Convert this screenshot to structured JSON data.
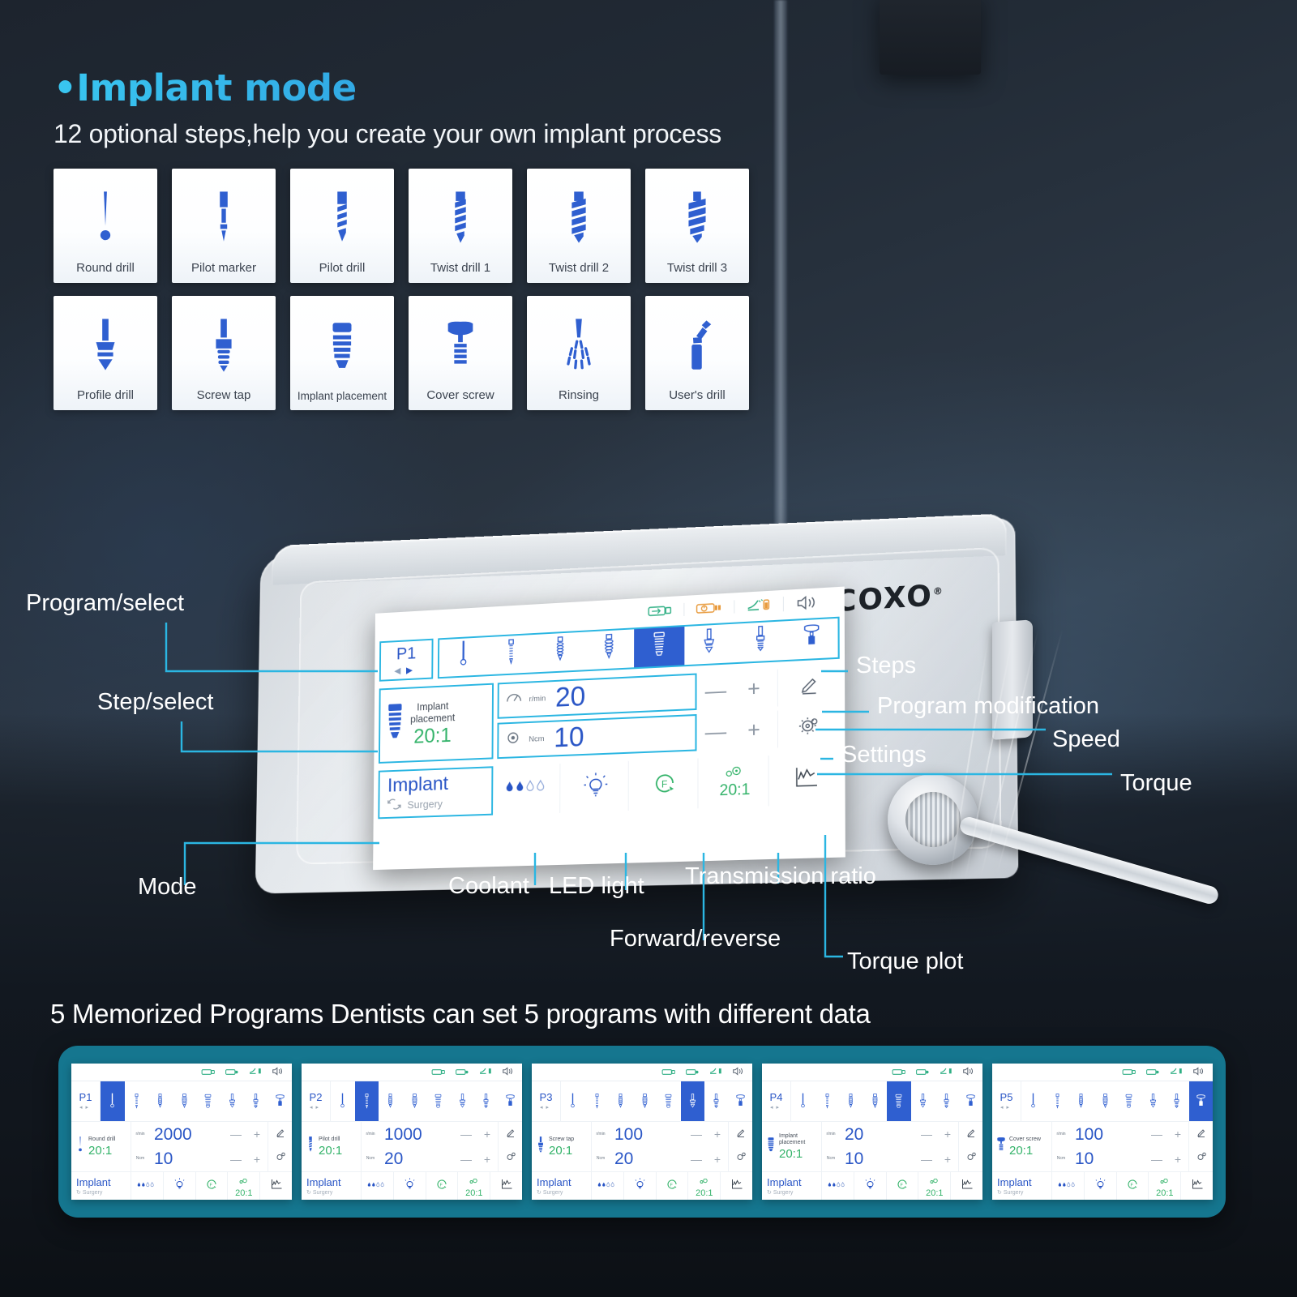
{
  "header": {
    "bullet": "•",
    "title": "Implant mode",
    "subtitle": "12 optional steps,help you create your own implant process"
  },
  "steps_grid": [
    {
      "label": "Round drill",
      "icon": "round-drill-icon"
    },
    {
      "label": "Pilot marker",
      "icon": "pilot-marker-icon"
    },
    {
      "label": "Pilot drill",
      "icon": "pilot-drill-icon"
    },
    {
      "label": "Twist drill 1",
      "icon": "twist-drill-1-icon"
    },
    {
      "label": "Twist drill 2",
      "icon": "twist-drill-2-icon"
    },
    {
      "label": "Twist drill 3",
      "icon": "twist-drill-3-icon"
    },
    {
      "label": "Profile drill",
      "icon": "profile-drill-icon"
    },
    {
      "label": "Screw tap",
      "icon": "screw-tap-icon"
    },
    {
      "label": "Implant placement",
      "icon": "implant-placement-icon"
    },
    {
      "label": "Cover screw",
      "icon": "cover-screw-icon"
    },
    {
      "label": "Rinsing",
      "icon": "rinsing-icon"
    },
    {
      "label": "User's drill",
      "icon": "users-drill-icon"
    }
  ],
  "device": {
    "brand": "COXO",
    "brand_mark": "®"
  },
  "screen": {
    "status_icons": [
      "usb-icon",
      "battery-power-icon",
      "foot-pedal-icon",
      "speaker-icon"
    ],
    "program": {
      "id": "P1",
      "prev": "◀",
      "next": "▶"
    },
    "step_strip": {
      "selected_index": 4,
      "icons": [
        "round-drill-icon",
        "pilot-drill-icon",
        "twist-drill-2-icon",
        "twist-drill-3-icon",
        "implant-placement-icon",
        "profile-drill-icon",
        "screw-tap-icon",
        "cover-screw-icon"
      ]
    },
    "tool": {
      "name_line1": "Implant",
      "name_line2": "placement",
      "ratio": "20:1"
    },
    "speed": {
      "unit": "r/min",
      "value": "20",
      "minus": "—",
      "plus": "+"
    },
    "torque": {
      "unit": "Ncm",
      "value": "10",
      "minus": "—",
      "plus": "+"
    },
    "right_buttons": [
      "pencil-edit-icon",
      "gear-settings-icon"
    ],
    "mode": {
      "title": "Implant",
      "sub": "Surgery"
    },
    "bottom_buttons": [
      {
        "icon": "coolant-drops-icon",
        "label": ""
      },
      {
        "icon": "led-bulb-icon",
        "label": ""
      },
      {
        "icon": "forward-reverse-icon",
        "label": ""
      },
      {
        "icon": "transmission-ratio-icon",
        "label": "20:1"
      },
      {
        "icon": "torque-plot-icon",
        "label": ""
      }
    ]
  },
  "callouts": {
    "program_select": "Program/select",
    "step_select": "Step/select",
    "mode": "Mode",
    "coolant": "Coolant",
    "led_light": "LED light",
    "forward_reverse": "Forward/reverse",
    "transmission_ratio": "Transmission ratio",
    "torque_plot": "Torque plot",
    "steps": "Steps",
    "program_modification": "Program modification",
    "speed": "Speed",
    "settings": "Settings",
    "torque": "Torque"
  },
  "memorized": {
    "title": "5 Memorized Programs Dentists can set 5 programs with different data",
    "programs": [
      {
        "id": "P1",
        "tool": "Round drill",
        "ratio": "20:1",
        "speed": "2000",
        "torque": "10",
        "selected_index": 0,
        "tool_icon": "round-drill-icon"
      },
      {
        "id": "P2",
        "tool": "Pilot drill",
        "ratio": "20:1",
        "speed": "1000",
        "torque": "20",
        "selected_index": 1,
        "tool_icon": "pilot-drill-icon"
      },
      {
        "id": "P3",
        "tool": "Screw tap",
        "ratio": "20:1",
        "speed": "100",
        "torque": "20",
        "selected_index": 5,
        "tool_icon": "screw-tap-icon"
      },
      {
        "id": "P4",
        "tool": "Implant placement",
        "ratio": "20:1",
        "speed": "20",
        "torque": "10",
        "selected_index": 4,
        "tool_icon": "implant-placement-icon"
      },
      {
        "id": "P5",
        "tool": "Cover screw",
        "ratio": "20:1",
        "speed": "100",
        "torque": "10",
        "selected_index": 7,
        "tool_icon": "cover-screw-icon"
      }
    ],
    "units": {
      "speed": "r/min",
      "torque": "Ncm"
    },
    "mode": {
      "title": "Implant",
      "sub": "Surgery"
    },
    "ratio_btn": "20:1",
    "minus": "—",
    "plus": "+"
  },
  "colors": {
    "accent_cyan": "#2bb6e2",
    "blue": "#2a56c6",
    "green": "#34b36a",
    "teal_panel": "#15768f",
    "heading_gradient_from": "#39c6f0",
    "heading_gradient_to": "#2b8fd8"
  }
}
